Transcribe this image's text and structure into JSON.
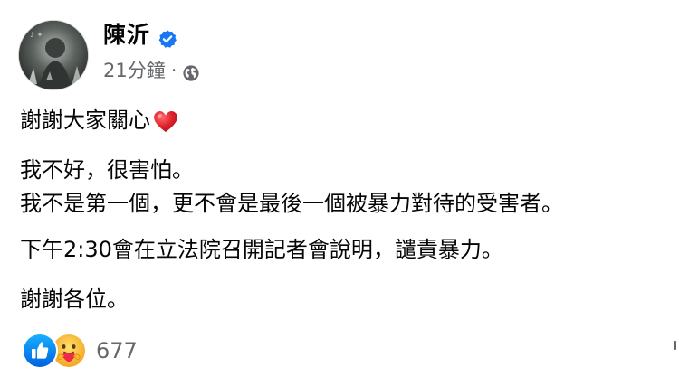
{
  "post": {
    "author_name": "陳沂",
    "timestamp": "21分鐘",
    "separator": "·",
    "privacy_icon": "globe-icon",
    "verified_icon": "verified-badge-icon",
    "lines": [
      "謝謝大家關心",
      "我不好，很害怕。",
      "我不是第一個，更不會是最後一個被暴力對待的受害者。",
      "下午2:30會在立法院召開記者會說明，譴責暴力。",
      "謝謝各位。"
    ],
    "heart_emoji": "heart-emoji-icon"
  },
  "reactions": {
    "icons": [
      "like-reaction-icon",
      "care-reaction-icon"
    ],
    "count": "677"
  },
  "colors": {
    "text": "#050505",
    "secondary": "#65676b",
    "like_blue": "#1877f2",
    "verified_blue": "#1877f2",
    "heart_red": "#e0245e",
    "care_yellow": "#f7b928"
  }
}
